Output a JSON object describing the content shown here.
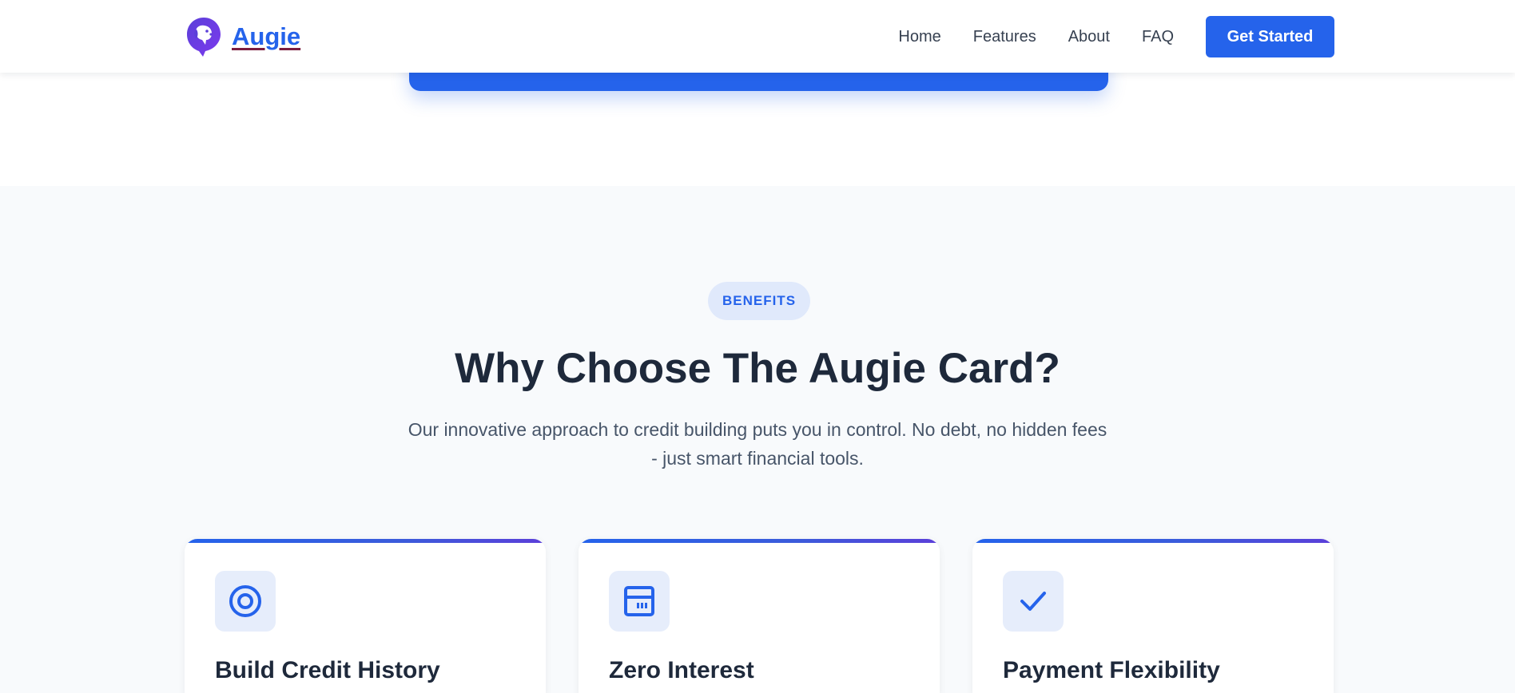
{
  "brand": {
    "name": "Augie",
    "logo_icon": "dog-head-chat-bubble-icon",
    "primary_color": "#2563eb",
    "accent_purple": "#5b3fd9"
  },
  "nav": {
    "items": [
      "Home",
      "Features",
      "About",
      "FAQ"
    ],
    "cta_label": "Get Started"
  },
  "benefits": {
    "badge": "BENEFITS",
    "title": "Why Choose The Augie Card?",
    "subtitle": "Our innovative approach to credit building puts you in control. No debt, no hidden fees - just smart financial tools.",
    "cards": [
      {
        "icon": "target-icon",
        "title": "Build Credit History"
      },
      {
        "icon": "calculator-icon",
        "title": "Zero Interest"
      },
      {
        "icon": "checkmark-icon",
        "title": "Payment Flexibility"
      }
    ]
  }
}
